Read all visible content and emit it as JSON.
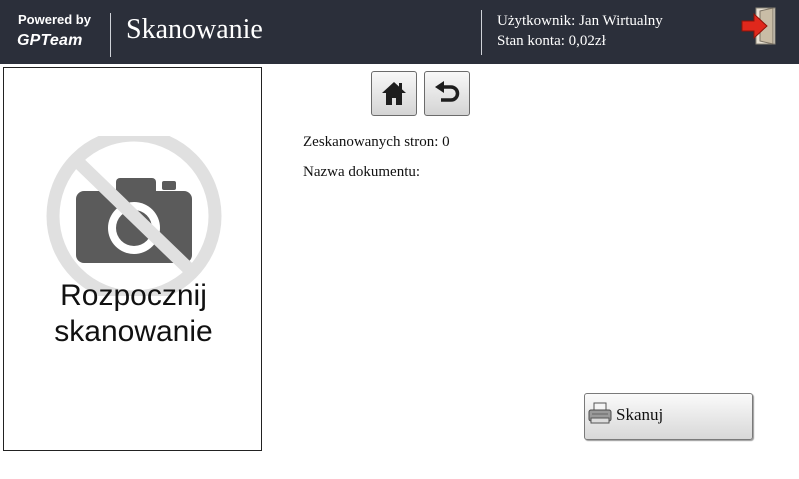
{
  "header": {
    "powered_by": "Powered by",
    "brand": "GPTeam",
    "title": "Skanowanie",
    "user_line": "Użytkownik: Jan Wirtualny",
    "balance_line": "Stan konta: 0,02zł",
    "exit_icon": "exit-door-icon"
  },
  "preview": {
    "start_line1": "Rozpocznij",
    "start_line2": "skanowanie",
    "icon": "no-camera-icon"
  },
  "nav": {
    "home_icon": "home-icon",
    "back_icon": "back-arrow-icon"
  },
  "info": {
    "scanned_pages": "Zeskanowanych stron: 0",
    "document_name": "Nazwa dokumentu:"
  },
  "scan_button": {
    "label": "Skanuj",
    "icon": "printer-icon"
  },
  "colors": {
    "header_bg": "#2b2f3a",
    "exit_arrow": "#e0281c"
  }
}
